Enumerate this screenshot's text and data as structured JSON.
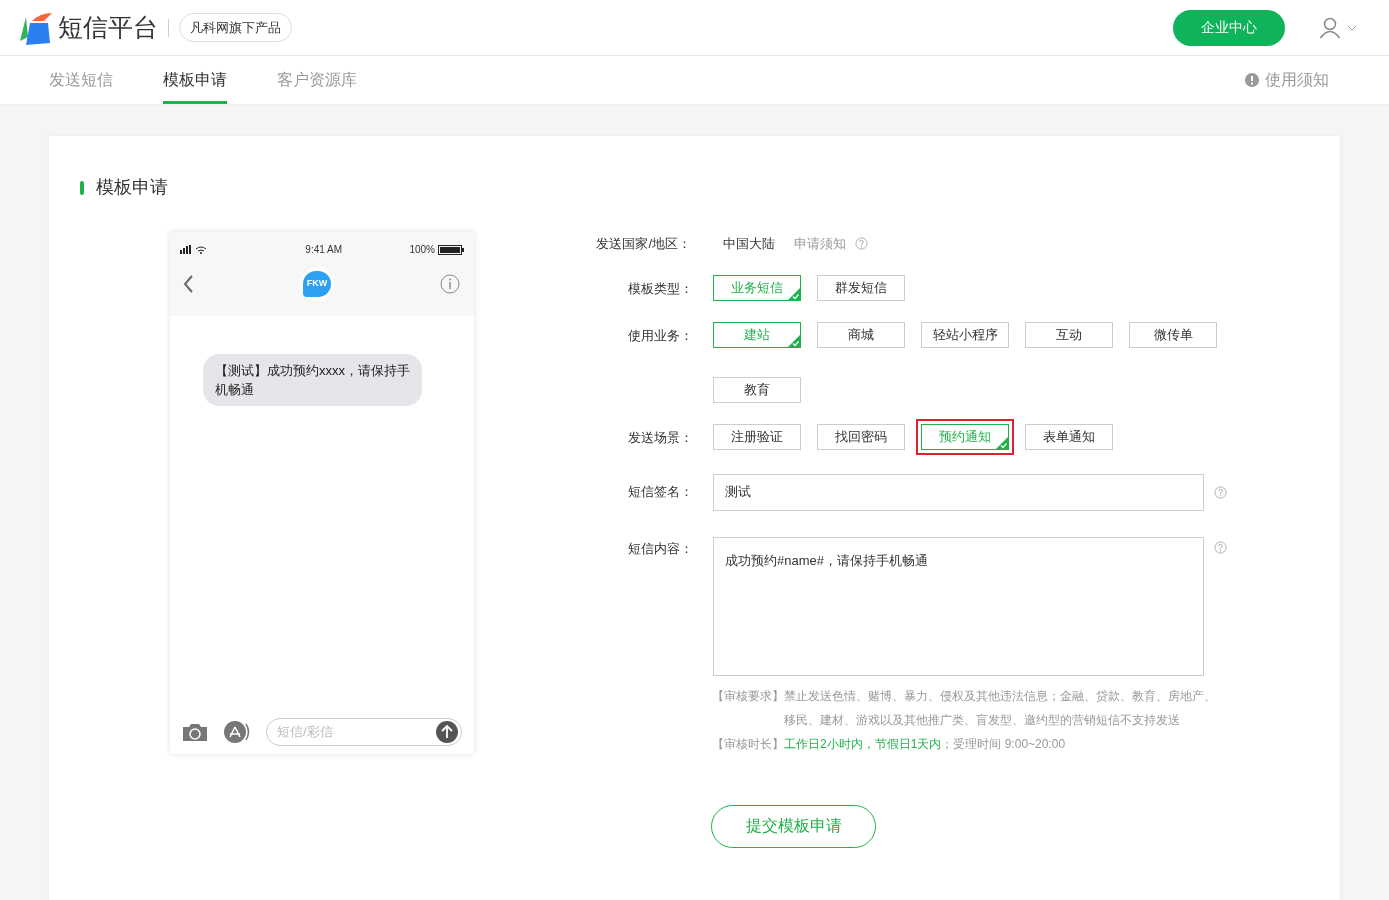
{
  "header": {
    "logo_text": "短信平台",
    "product_badge": "凡科网旗下产品",
    "enterprise_button": "企业中心"
  },
  "nav": {
    "tabs": [
      {
        "label": "发送短信",
        "selected": false
      },
      {
        "label": "模板申请",
        "selected": true
      },
      {
        "label": "客户资源库",
        "selected": false
      }
    ],
    "notice_link": "使用须知"
  },
  "card": {
    "title": "模板申请"
  },
  "preview": {
    "status_time": "9:41 AM",
    "battery": "100%",
    "avatar_text": "FKW",
    "message": "【测试】成功预约xxxx，请保持手机畅通",
    "input_placeholder": "短信/彩信"
  },
  "form": {
    "country": {
      "label": "发送国家/地区：",
      "value": "中国大陆",
      "link": "申请须知"
    },
    "groups": [
      {
        "label": "模板类型：",
        "options": [
          {
            "label": "业务短信",
            "selected": true,
            "highlighted": false
          },
          {
            "label": "群发短信",
            "selected": false,
            "highlighted": false
          }
        ]
      },
      {
        "label": "使用业务：",
        "options": [
          {
            "label": "建站",
            "selected": true,
            "highlighted": false
          },
          {
            "label": "商城",
            "selected": false,
            "highlighted": false
          },
          {
            "label": "轻站小程序",
            "selected": false,
            "highlighted": false
          },
          {
            "label": "互动",
            "selected": false,
            "highlighted": false
          },
          {
            "label": "微传单",
            "selected": false,
            "highlighted": false
          },
          {
            "label": "教育",
            "selected": false,
            "highlighted": false
          }
        ]
      },
      {
        "label": "发送场景：",
        "options": [
          {
            "label": "注册验证",
            "selected": false,
            "highlighted": false
          },
          {
            "label": "找回密码",
            "selected": false,
            "highlighted": false
          },
          {
            "label": "预约通知",
            "selected": true,
            "highlighted": true
          },
          {
            "label": "表单通知",
            "selected": false,
            "highlighted": false
          }
        ]
      }
    ],
    "signature": {
      "label": "短信签名：",
      "value": "测试"
    },
    "content": {
      "label": "短信内容：",
      "value": "成功预约#name#，请保持手机畅通"
    },
    "notes": [
      {
        "tag": "【审核要求】",
        "segments": [
          {
            "text": "禁止发送色情、赌博、暴力、侵权及其他违法信息；金融、贷款、教育、房地产、移民、建材、游戏以及其他推广类、盲发型、邀约型的营销短信不支持发送",
            "kind": "plain"
          }
        ]
      },
      {
        "tag": "【审核时长】",
        "segments": [
          {
            "text": "工作日2小时内，节假日1天内",
            "kind": "emphasis"
          },
          {
            "text": "；受理时间 9:00~20:00",
            "kind": "plain"
          }
        ]
      }
    ],
    "submit": "提交模板申请"
  }
}
